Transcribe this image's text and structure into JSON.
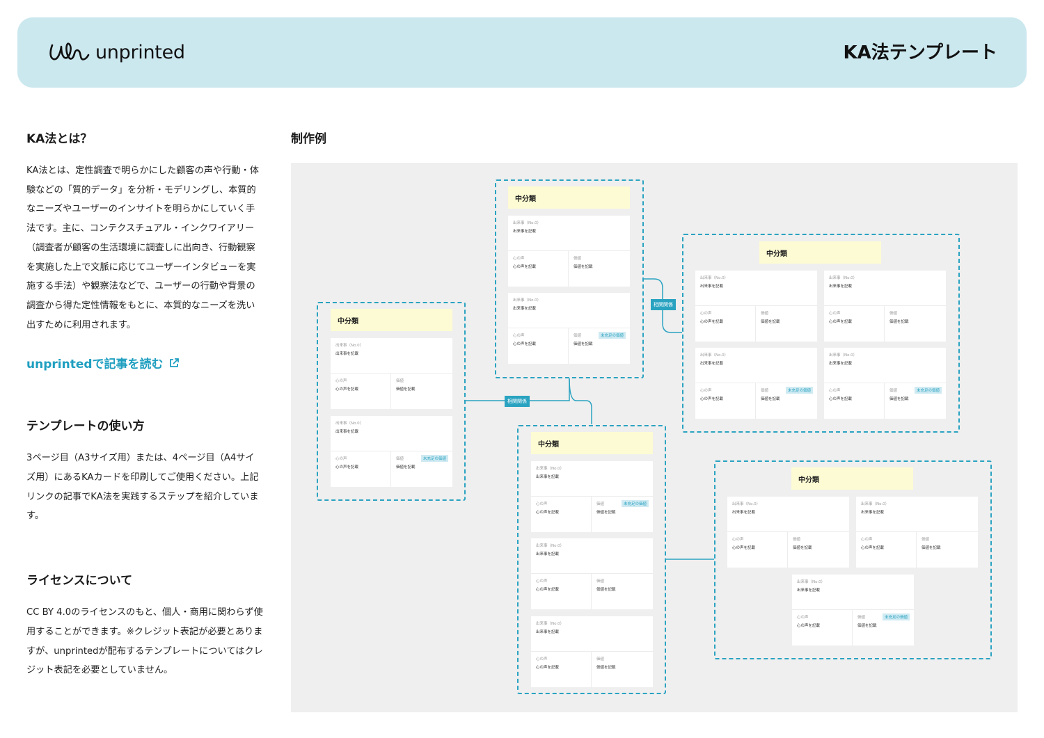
{
  "header": {
    "brand": "unprinted",
    "title": "KA法テンプレート"
  },
  "about": {
    "heading": "KA法とは？",
    "body": "KA法とは、定性調査で明らかにした顧客の声や行動・体験などの「質的データ」を分析・モデリングし、本質的なニーズやユーザーのインサイトを明らかにしていく手法です。主に、コンテクスチュアル・インクワイアリー（調査者が顧客の生活環境に調査しに出向き、行動観察を実施した上で文脈に応じてユーザーインタビューを実施する手法）や観察法などで、ユーザーの行動や背景の調査から得た定性情報をもとに、本質的なニーズを洗い出すために利用されます。",
    "link": "unprintedで記事を読む"
  },
  "usage": {
    "heading": "テンプレートの使い方",
    "body": "3ページ目（A3サイズ用）または、4ページ目（A4サイズ用）にあるKAカードを印刷してご使用ください。上記リンクの記事でKA法を実践するステップを紹介しています。"
  },
  "license": {
    "heading": "ライセンスについて",
    "body": "CC BY 4.0のライセンスのもと、個人・商用に関わらず使用することができます。※クレジット表記が必要とありますが、unprintedが配布するテンプレートについてはクレジット表記を必要としていません。"
  },
  "example": {
    "heading": "制作例",
    "category_label": "中分類",
    "relation_label": "相関関係",
    "card": {
      "event_label": "出来事（No.0）",
      "event_value": "出来事を記載",
      "voice_label": "心の声",
      "voice_value": "心の声を記載",
      "value_label": "価値",
      "value_value": "価値を記載",
      "unmet_label": "未充足の価値"
    }
  }
}
